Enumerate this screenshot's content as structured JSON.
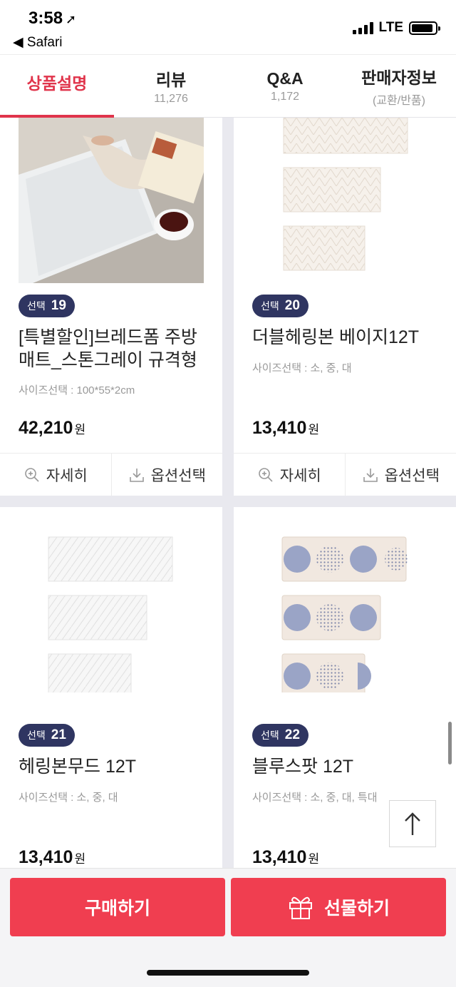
{
  "status_bar": {
    "time": "3:58",
    "back_app": "Safari",
    "network": "LTE",
    "battery_level": 0.9
  },
  "tabs": [
    {
      "label": "상품설명",
      "sub": ""
    },
    {
      "label": "리뷰",
      "sub": "11,276"
    },
    {
      "label": "Q&A",
      "sub": "1,172"
    },
    {
      "label": "판매자정보",
      "sub": "(교환/반품)"
    }
  ],
  "products": [
    {
      "badge_label": "선택",
      "badge_num": "19",
      "title": "[특별할인]브레드폼 주방매트_스톤그레이 규격형",
      "option": "사이즈선택 : 100*55*2cm",
      "price": "42,210",
      "currency": "원",
      "image": "photo-lifestyle"
    },
    {
      "badge_label": "선택",
      "badge_num": "20",
      "title": "더블헤링본 베이지12T",
      "option": "사이즈선택 : 소, 중, 대",
      "price": "13,410",
      "currency": "원",
      "image": "double-herringbone-beige"
    },
    {
      "badge_label": "선택",
      "badge_num": "21",
      "title": "헤링본무드 12T",
      "option": "사이즈선택 : 소, 중, 대",
      "price": "13,410",
      "currency": "원",
      "image": "herringbone-mood"
    },
    {
      "badge_label": "선택",
      "badge_num": "22",
      "title": "블루스팟 12T",
      "option": "사이즈선택 : 소, 중, 대, 특대",
      "price": "13,410",
      "currency": "원",
      "image": "blue-spot"
    }
  ],
  "card_actions": {
    "detail_label": "자세히",
    "option_label": "옵션선택"
  },
  "bottom_bar": {
    "buy_label": "구매하기",
    "gift_label": "선물하기"
  },
  "colors": {
    "accent": "#e0344b",
    "buy_button": "#f03e50",
    "badge": "#2f3561"
  }
}
